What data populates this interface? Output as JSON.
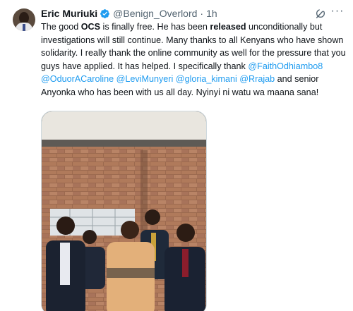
{
  "author": {
    "name": "Eric Muriuki",
    "handle": "@Benign_Overlord",
    "separator": "·",
    "time": "1h"
  },
  "icons": {
    "verified": "verified-badge-icon",
    "grok": "grok-icon",
    "more": "more-options-icon"
  },
  "colors": {
    "link": "#1d9bf0",
    "secondary_text": "#536471",
    "verified": "#1d9bf0"
  },
  "tweet": {
    "seg1": "The good ",
    "seg2": "OCS",
    "seg3": " is finally free. He has been ",
    "seg4": "released",
    "seg5": " unconditionally but investigations will still continue. Many thanks to all Kenyans who have shown solidarity. I really thank the online community as well for the pressure that you guys have applied. It has helped. I specifically thank ",
    "mentions": [
      "@FaithOdhiambo8",
      "@OduorACaroline",
      "@LeviMunyeri",
      "@gloria_kimani",
      "@Rrajab"
    ],
    "seg6": " and senior Anyonka who has been with us all day. Nyinyi ni watu wa maana sana!"
  },
  "media": {
    "icon": "photo-of-five-men-in-front-of-brick-building"
  }
}
